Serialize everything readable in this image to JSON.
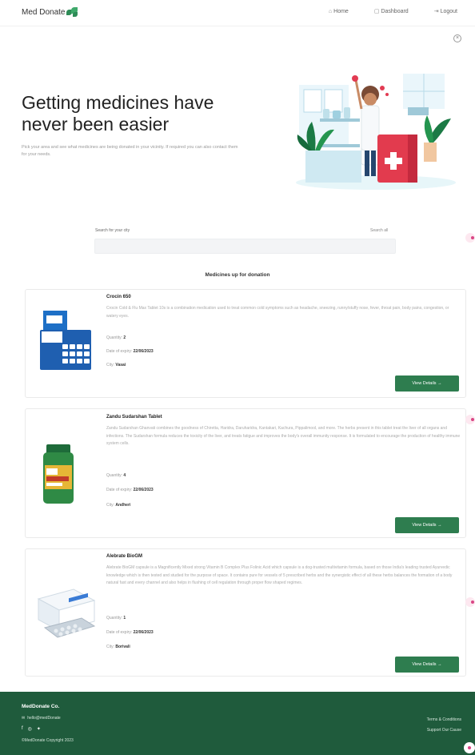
{
  "nav": {
    "brand": "Med Donate",
    "links": [
      {
        "icon": "home-icon",
        "glyph": "⌂",
        "label": "Home"
      },
      {
        "icon": "dashboard-icon",
        "glyph": "▢",
        "label": "Dashboard"
      },
      {
        "icon": "logout-icon",
        "glyph": "⇥",
        "label": "Logout"
      }
    ]
  },
  "hero": {
    "title": "Getting medicines have never been easier",
    "subtitle": "Pick your area and see what medicines are being donated in your vicinity. If required you can also contact them for your needs."
  },
  "search": {
    "label": "Search for your city",
    "hint": "Search all"
  },
  "section_title": "Medicines up for donation",
  "medicines": [
    {
      "name": "Crocin 650",
      "description": "Crocin Cold & Flu Max Tablet 10s is a combination medication used to treat common cold symptoms such as headache, sneezing, runny/stuffy nose, fever, throat pain, body pains, congestion, or watery eyes.",
      "quantity_label": "Quantity:",
      "quantity": "2",
      "expiry_label": "Date of expiry:",
      "expiry": "22/06/2023",
      "city_label": "City:",
      "city": "Vasai",
      "button": "View Details →"
    },
    {
      "name": "Zandu Sudarshan Tablet",
      "description": "Zandu Sudarshan Ghanvati combines the goodness of Chiretta, Haridra, Daruharidra, Kantakari, Kachura, Pippalimool, and more. The herbs present in this tablet treat the liver of all organs and infections. The Sudarshan formula reduces the toxicity of the liver, and treats fatigue and improves the body's overall immunity response. It is formulated to encourage the production of healthy immune system cells.",
      "quantity_label": "Quantity:",
      "quantity": "4",
      "expiry_label": "Date of expiry:",
      "expiry": "22/06/2023",
      "city_label": "City:",
      "city": "Andheri",
      "button": "View Details →"
    },
    {
      "name": "Alebrate BioGM",
      "description": "Alebrate BioGM capsule is a Magnificently Mixed strong Vitamin B Complex Plus Folinic Acid which capsule is a dog-trusted multivitamin formula, based on those India's leading trusted Ayurvedic knowledge which is then tested and studied for the purpose of space. It contains pure for vessels of 5 prescribed herbs and the synergistic effect of all these herbs balances the formation of a body natural fast and every channel and also helps in flushing of cell regulation through proper flow shaped regimes.",
      "quantity_label": "Quantity:",
      "quantity": "1",
      "expiry_label": "Date of expiry:",
      "expiry": "22/06/2023",
      "city_label": "City:",
      "city": "Borivali",
      "button": "View Details →"
    }
  ],
  "footer": {
    "brand": "MedDonate Co.",
    "email": "hello@medDonate",
    "copyright": "©MedDonate Copyright 2023",
    "links": [
      "Terms & Conditions",
      "Support Our Cause"
    ]
  },
  "colors": {
    "primary": "#2e7d4f",
    "footer": "#1f5b3c",
    "accent": "#d94685"
  }
}
